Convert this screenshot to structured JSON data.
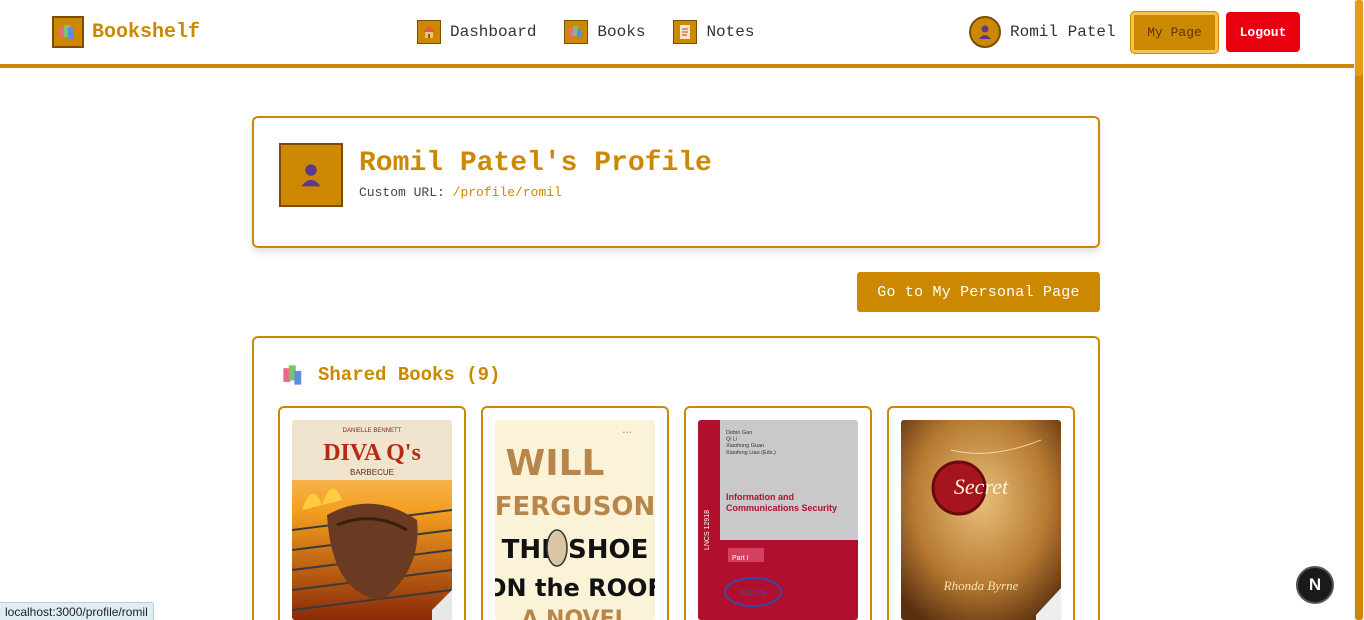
{
  "header": {
    "app_name": "Bookshelf",
    "nav": [
      {
        "label": "Dashboard",
        "icon": "house-icon"
      },
      {
        "label": "Books",
        "icon": "books-icon"
      },
      {
        "label": "Notes",
        "icon": "note-icon"
      }
    ],
    "user_name": "Romil Patel",
    "my_page_label": "My Page",
    "logout_label": "Logout"
  },
  "profile": {
    "title": "Romil Patel's Profile",
    "custom_url_label": "Custom URL:",
    "custom_url_value": "/profile/romil"
  },
  "personal_page_button": "Go to My Personal Page",
  "shared_books": {
    "heading": "Shared Books (9)",
    "books": [
      {
        "cover_text_top": "DANIELLE BENNETT",
        "cover_title": "DIVA Q's",
        "cover_sub": "BARBECUE"
      },
      {
        "cover_line1": "WILL",
        "cover_line2": "FERGUSON",
        "cover_line3": "THE SHOE",
        "cover_line4": "ON the ROOF",
        "cover_line5": "A NOVEL"
      },
      {
        "editors": "Debin Gao\nQi Li\nXiaohong Guan\nXiaofeng Liao (Eds.)",
        "cover_title": "Information and\nCommunications Security",
        "series": "LNCS 12918",
        "part": "Part I"
      },
      {
        "cover_title": "Secret",
        "author": "Rhonda Byrne"
      }
    ]
  },
  "status_url": "localhost:3000/profile/romil",
  "next_badge": "N",
  "colors": {
    "accent": "#cc8800",
    "accent_dark": "#7a4d00",
    "logout": "#e8000f"
  }
}
